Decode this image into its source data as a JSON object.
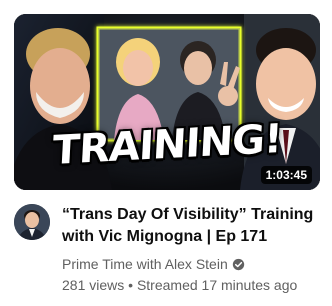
{
  "video": {
    "title": "“Trans Day Of Visibility” Training with Vic Mignogna | Ep 171",
    "thumbnail_text": "TRAINING!",
    "duration": "1:03:45",
    "channel": "Prime Time with Alex Stein",
    "verified": true,
    "views": "281 views",
    "separator": "•",
    "streamed": "Streamed 17 minutes ago"
  },
  "colors": {
    "title_text": "#0f0f0f",
    "secondary_text": "#606060",
    "thumbnail_frame_glow": "#e8ff2a",
    "duration_badge_bg": "#000000"
  },
  "icons": {
    "verified": "check-circle-icon"
  }
}
